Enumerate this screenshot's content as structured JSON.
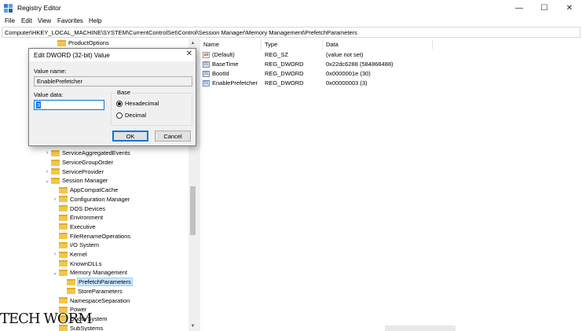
{
  "window": {
    "title": "Registry Editor",
    "controls": {
      "minimize": "—",
      "maximize": "☐",
      "close": "✕"
    }
  },
  "menu": [
    "File",
    "Edit",
    "View",
    "Favorites",
    "Help"
  ],
  "address": "Computer\\HKEY_LOCAL_MACHINE\\SYSTEM\\CurrentControlSet\\Control\\Session Manager\\Memory Management\\PrefetchParameters",
  "tree": {
    "items": [
      {
        "label": "ProductOptions",
        "chevron": ""
      },
      {
        "label": "ServiceAggregatedEvents",
        "chevron": "›"
      },
      {
        "label": "ServiceGroupOrder",
        "chevron": ""
      },
      {
        "label": "ServiceProvider",
        "chevron": "›"
      },
      {
        "label": "Session Manager",
        "chevron": "⌄"
      },
      {
        "label": "AppCompatCache",
        "chevron": ""
      },
      {
        "label": "Configuration Manager",
        "chevron": "›"
      },
      {
        "label": "DOS Devices",
        "chevron": ""
      },
      {
        "label": "Environment",
        "chevron": ""
      },
      {
        "label": "Executive",
        "chevron": ""
      },
      {
        "label": "FileRenameOperations",
        "chevron": ""
      },
      {
        "label": "I/O System",
        "chevron": ""
      },
      {
        "label": "Kernel",
        "chevron": "›"
      },
      {
        "label": "KnownDLLs",
        "chevron": ""
      },
      {
        "label": "Memory Management",
        "chevron": "⌄"
      },
      {
        "label": "PrefetchParameters",
        "chevron": ""
      },
      {
        "label": "StoreParameters",
        "chevron": ""
      },
      {
        "label": "NamespaceSeparation",
        "chevron": ""
      },
      {
        "label": "Power",
        "chevron": ""
      },
      {
        "label": "Quota System",
        "chevron": ""
      },
      {
        "label": "SubSystems",
        "chevron": ""
      }
    ],
    "selected": "PrefetchParameters"
  },
  "values": {
    "columns": {
      "name": "Name",
      "type": "Type",
      "data": "Data"
    },
    "rows": [
      {
        "name": "(Default)",
        "type": "REG_SZ",
        "data": "(value not set)",
        "icon": "ab"
      },
      {
        "name": "BaseTime",
        "type": "REG_DWORD",
        "data": "0x22dc6288 (584868488)",
        "icon": "dword"
      },
      {
        "name": "BootId",
        "type": "REG_DWORD",
        "data": "0x0000001e (30)",
        "icon": "dword"
      },
      {
        "name": "EnablePrefetcher",
        "type": "REG_DWORD",
        "data": "0x00000003 (3)",
        "icon": "dword"
      }
    ]
  },
  "dialog": {
    "title": "Edit DWORD (32-bit) Value",
    "close": "✕",
    "value_name_label": "Value name:",
    "value_name": "EnablePrefetcher",
    "value_data_label": "Value data:",
    "value_data": "3",
    "base_label": "Base",
    "hex_label": "Hexadecimal",
    "dec_label": "Decimal",
    "selected_base": "Hexadecimal",
    "ok_label": "OK",
    "cancel_label": "Cancel"
  },
  "watermark": "TECH WORM"
}
